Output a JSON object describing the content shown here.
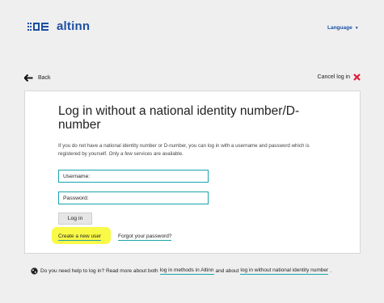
{
  "header": {
    "logo_text": "altinn",
    "language_label": "Language"
  },
  "topbar": {
    "back_label": "Back",
    "cancel_label": "Cancel log in"
  },
  "card": {
    "title": "Log in without a national identity number/D-number",
    "intro": "If you do not have a national identity number or D-number, you can log in with a username and password which is registered by yourself. Only a few services are available.",
    "username_placeholder": "Username:",
    "password_placeholder": "Password:",
    "login_button": "Log in",
    "create_user_link": "Create a new user",
    "forgot_password_link": "Forgot your password?"
  },
  "help": {
    "text_1": "Do you need help to log in? Read more about both",
    "link_1": "log in methods in Altinn",
    "text_2": "and about",
    "link_2": "log in without national identity number",
    "text_3": "."
  },
  "colors": {
    "brand": "#1d4fa3",
    "accent": "#1aa3ad",
    "cancel": "#e0193a",
    "highlight": "#f7f700"
  }
}
